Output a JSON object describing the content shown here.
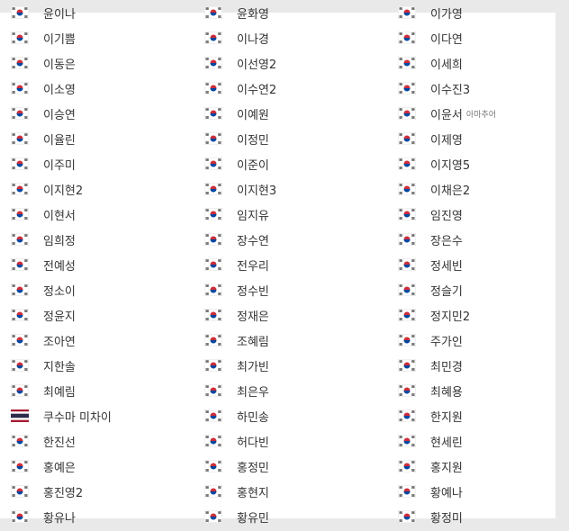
{
  "colors": {
    "kr_red": "#cd2e3a",
    "kr_blue": "#0047a0",
    "th_red": "#a51931",
    "th_blue": "#2d2a4a"
  },
  "roster": [
    {
      "name": "윤이나",
      "flag": "kr-flag-icon"
    },
    {
      "name": "윤화영",
      "flag": "kr-flag-icon"
    },
    {
      "name": "이가영",
      "flag": "kr-flag-icon"
    },
    {
      "name": "이기쁨",
      "flag": "kr-flag-icon"
    },
    {
      "name": "이나경",
      "flag": "kr-flag-icon"
    },
    {
      "name": "이다연",
      "flag": "kr-flag-icon"
    },
    {
      "name": "이동은",
      "flag": "kr-flag-icon"
    },
    {
      "name": "이선영2",
      "flag": "kr-flag-icon"
    },
    {
      "name": "이세희",
      "flag": "kr-flag-icon"
    },
    {
      "name": "이소영",
      "flag": "kr-flag-icon"
    },
    {
      "name": "이수연2",
      "flag": "kr-flag-icon"
    },
    {
      "name": "이수진3",
      "flag": "kr-flag-icon"
    },
    {
      "name": "이승연",
      "flag": "kr-flag-icon"
    },
    {
      "name": "이예원",
      "flag": "kr-flag-icon"
    },
    {
      "name": "이윤서",
      "flag": "kr-flag-icon",
      "tag": "아마추어"
    },
    {
      "name": "이율린",
      "flag": "kr-flag-icon"
    },
    {
      "name": "이정민",
      "flag": "kr-flag-icon"
    },
    {
      "name": "이제영",
      "flag": "kr-flag-icon"
    },
    {
      "name": "이주미",
      "flag": "kr-flag-icon"
    },
    {
      "name": "이준이",
      "flag": "kr-flag-icon"
    },
    {
      "name": "이지영5",
      "flag": "kr-flag-icon"
    },
    {
      "name": "이지현2",
      "flag": "kr-flag-icon"
    },
    {
      "name": "이지현3",
      "flag": "kr-flag-icon"
    },
    {
      "name": "이채은2",
      "flag": "kr-flag-icon"
    },
    {
      "name": "이현서",
      "flag": "kr-flag-icon"
    },
    {
      "name": "임지유",
      "flag": "kr-flag-icon"
    },
    {
      "name": "임진영",
      "flag": "kr-flag-icon"
    },
    {
      "name": "임희정",
      "flag": "kr-flag-icon"
    },
    {
      "name": "장수연",
      "flag": "kr-flag-icon"
    },
    {
      "name": "장은수",
      "flag": "kr-flag-icon"
    },
    {
      "name": "전예성",
      "flag": "kr-flag-icon"
    },
    {
      "name": "전우리",
      "flag": "kr-flag-icon"
    },
    {
      "name": "정세빈",
      "flag": "kr-flag-icon"
    },
    {
      "name": "정소이",
      "flag": "kr-flag-icon"
    },
    {
      "name": "정수빈",
      "flag": "kr-flag-icon"
    },
    {
      "name": "정슬기",
      "flag": "kr-flag-icon"
    },
    {
      "name": "정윤지",
      "flag": "kr-flag-icon"
    },
    {
      "name": "정재은",
      "flag": "kr-flag-icon"
    },
    {
      "name": "정지민2",
      "flag": "kr-flag-icon"
    },
    {
      "name": "조아연",
      "flag": "kr-flag-icon"
    },
    {
      "name": "조혜림",
      "flag": "kr-flag-icon"
    },
    {
      "name": "주가인",
      "flag": "kr-flag-icon"
    },
    {
      "name": "지한솔",
      "flag": "kr-flag-icon"
    },
    {
      "name": "최가빈",
      "flag": "kr-flag-icon"
    },
    {
      "name": "최민경",
      "flag": "kr-flag-icon"
    },
    {
      "name": "최예림",
      "flag": "kr-flag-icon"
    },
    {
      "name": "최은우",
      "flag": "kr-flag-icon"
    },
    {
      "name": "최혜용",
      "flag": "kr-flag-icon"
    },
    {
      "name": "쿠수마 미차이",
      "flag": "th-flag-icon"
    },
    {
      "name": "하민송",
      "flag": "kr-flag-icon"
    },
    {
      "name": "한지원",
      "flag": "kr-flag-icon"
    },
    {
      "name": "한진선",
      "flag": "kr-flag-icon"
    },
    {
      "name": "허다빈",
      "flag": "kr-flag-icon"
    },
    {
      "name": "현세린",
      "flag": "kr-flag-icon"
    },
    {
      "name": "홍예은",
      "flag": "kr-flag-icon"
    },
    {
      "name": "홍정민",
      "flag": "kr-flag-icon"
    },
    {
      "name": "홍지원",
      "flag": "kr-flag-icon"
    },
    {
      "name": "홍진영2",
      "flag": "kr-flag-icon"
    },
    {
      "name": "홍현지",
      "flag": "kr-flag-icon"
    },
    {
      "name": "황예나",
      "flag": "kr-flag-icon"
    },
    {
      "name": "황유나",
      "flag": "kr-flag-icon"
    },
    {
      "name": "황유민",
      "flag": "kr-flag-icon"
    },
    {
      "name": "황정미",
      "flag": "kr-flag-icon"
    }
  ]
}
